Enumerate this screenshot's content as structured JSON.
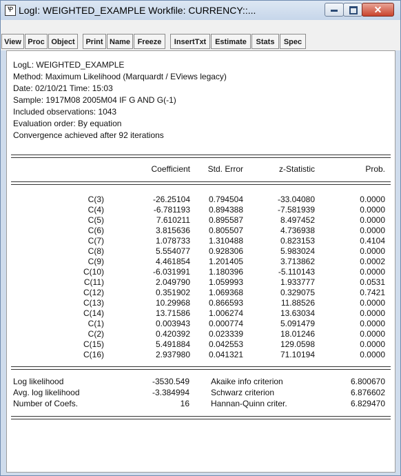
{
  "window": {
    "title": "LogI: WEIGHTED_EXAMPLE   Workfile: CURRENCY::...",
    "close_glyph": "✕"
  },
  "toolbar": {
    "buttons": [
      "View",
      "Proc",
      "Object",
      "Print",
      "Name",
      "Freeze",
      "InsertTxt",
      "Estimate",
      "Stats",
      "Spec"
    ]
  },
  "header": {
    "lines": [
      "LogL: WEIGHTED_EXAMPLE",
      "Method: Maximum Likelihood  (Marquardt / EViews legacy)",
      "Date: 02/10/21   Time: 15:03",
      "Sample: 1917M08 2005M04 IF G AND G(-1)",
      "Included observations: 1043",
      "Evaluation order: By equation",
      "Convergence achieved after 92 iterations"
    ]
  },
  "table": {
    "columns": [
      "Coefficient",
      "Std. Error",
      "z-Statistic",
      "Prob."
    ],
    "rows": [
      {
        "name": "C(3)",
        "coef": "-26.25104",
        "se": "0.794504",
        "z": "-33.04080",
        "p": "0.0000"
      },
      {
        "name": "C(4)",
        "coef": "-6.781193",
        "se": "0.894388",
        "z": "-7.581939",
        "p": "0.0000"
      },
      {
        "name": "C(5)",
        "coef": "7.610211",
        "se": "0.895587",
        "z": "8.497452",
        "p": "0.0000"
      },
      {
        "name": "C(6)",
        "coef": "3.815636",
        "se": "0.805507",
        "z": "4.736938",
        "p": "0.0000"
      },
      {
        "name": "C(7)",
        "coef": "1.078733",
        "se": "1.310488",
        "z": "0.823153",
        "p": "0.4104"
      },
      {
        "name": "C(8)",
        "coef": "5.554077",
        "se": "0.928306",
        "z": "5.983024",
        "p": "0.0000"
      },
      {
        "name": "C(9)",
        "coef": "4.461854",
        "se": "1.201405",
        "z": "3.713862",
        "p": "0.0002"
      },
      {
        "name": "C(10)",
        "coef": "-6.031991",
        "se": "1.180396",
        "z": "-5.110143",
        "p": "0.0000"
      },
      {
        "name": "C(11)",
        "coef": "2.049790",
        "se": "1.059993",
        "z": "1.933777",
        "p": "0.0531"
      },
      {
        "name": "C(12)",
        "coef": "0.351902",
        "se": "1.069368",
        "z": "0.329075",
        "p": "0.7421"
      },
      {
        "name": "C(13)",
        "coef": "10.29968",
        "se": "0.866593",
        "z": "11.88526",
        "p": "0.0000"
      },
      {
        "name": "C(14)",
        "coef": "13.71586",
        "se": "1.006274",
        "z": "13.63034",
        "p": "0.0000"
      },
      {
        "name": "C(1)",
        "coef": "0.003943",
        "se": "0.000774",
        "z": "5.091479",
        "p": "0.0000"
      },
      {
        "name": "C(2)",
        "coef": "0.420392",
        "se": "0.023339",
        "z": "18.01246",
        "p": "0.0000"
      },
      {
        "name": "C(15)",
        "coef": "5.491884",
        "se": "0.042553",
        "z": "129.0598",
        "p": "0.0000"
      },
      {
        "name": "C(16)",
        "coef": "2.937980",
        "se": "0.041321",
        "z": "71.10194",
        "p": "0.0000"
      }
    ]
  },
  "stats": [
    {
      "label1": "Log likelihood",
      "value1": "-3530.549",
      "label2": "Akaike info criterion",
      "value2": "6.800670"
    },
    {
      "label1": "Avg. log likelihood",
      "value1": "-3.384994",
      "label2": "Schwarz criterion",
      "value2": "6.876602"
    },
    {
      "label1": "Number of Coefs.",
      "value1": "16",
      "label2": "Hannan-Quinn criter.",
      "value2": "6.829470"
    }
  ]
}
